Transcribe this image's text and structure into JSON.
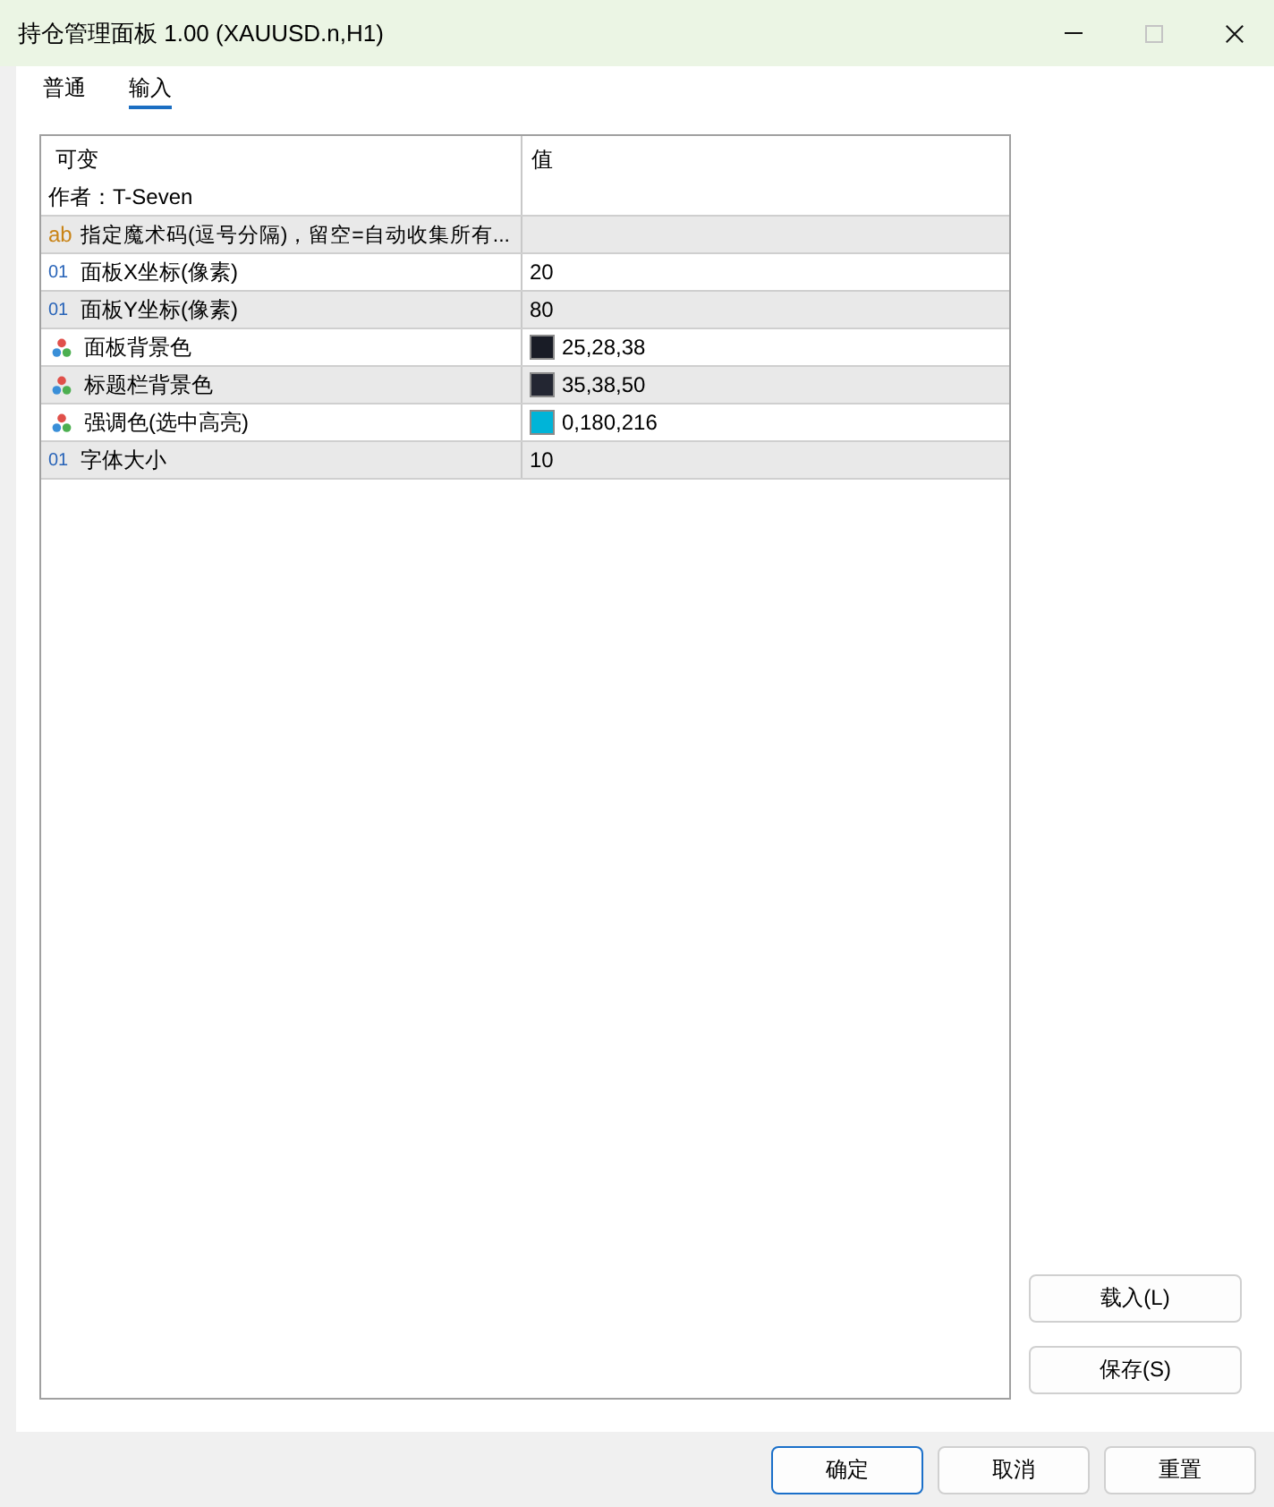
{
  "window": {
    "title": "持仓管理面板 1.00 (XAUUSD.n,H1)",
    "controls": [
      {
        "kind": "minimize",
        "disabled": false
      },
      {
        "kind": "maximize",
        "disabled": true
      },
      {
        "kind": "close",
        "disabled": false
      }
    ]
  },
  "tabs": [
    {
      "label": "普通",
      "selected": false
    },
    {
      "label": "输入",
      "selected": true
    }
  ],
  "table": {
    "columns": [
      "可变",
      "值"
    ],
    "rows": [
      {
        "kind": "comment",
        "name": "作者：T-Seven"
      },
      {
        "kind": "string",
        "type_glyph": "ab",
        "name": "指定魔术码(逗号分隔)，留空=自动收集所有..."
      },
      {
        "kind": "int",
        "type_glyph": "01",
        "name": "面板X坐标(像素)",
        "value": "20"
      },
      {
        "kind": "int",
        "type_glyph": "01",
        "name": "面板Y坐标(像素)",
        "value": "80"
      },
      {
        "kind": "color",
        "name": "面板背景色",
        "value": "25,28,38",
        "color": "#191c26"
      },
      {
        "kind": "color",
        "name": "标题栏背景色",
        "value": "35,38,50",
        "color": "#232632"
      },
      {
        "kind": "color",
        "name": "强调色(选中高亮)",
        "value": "0,180,216",
        "color": "#00b4d8"
      },
      {
        "kind": "int",
        "type_glyph": "01",
        "name": "字体大小",
        "value": "10"
      }
    ]
  },
  "side_buttons": [
    {
      "label": "载入(L)"
    },
    {
      "label": "保存(S)"
    }
  ],
  "buttons": [
    {
      "label": "确定",
      "default": true
    },
    {
      "label": "取消",
      "default": false
    },
    {
      "label": "重置",
      "default": false
    }
  ]
}
